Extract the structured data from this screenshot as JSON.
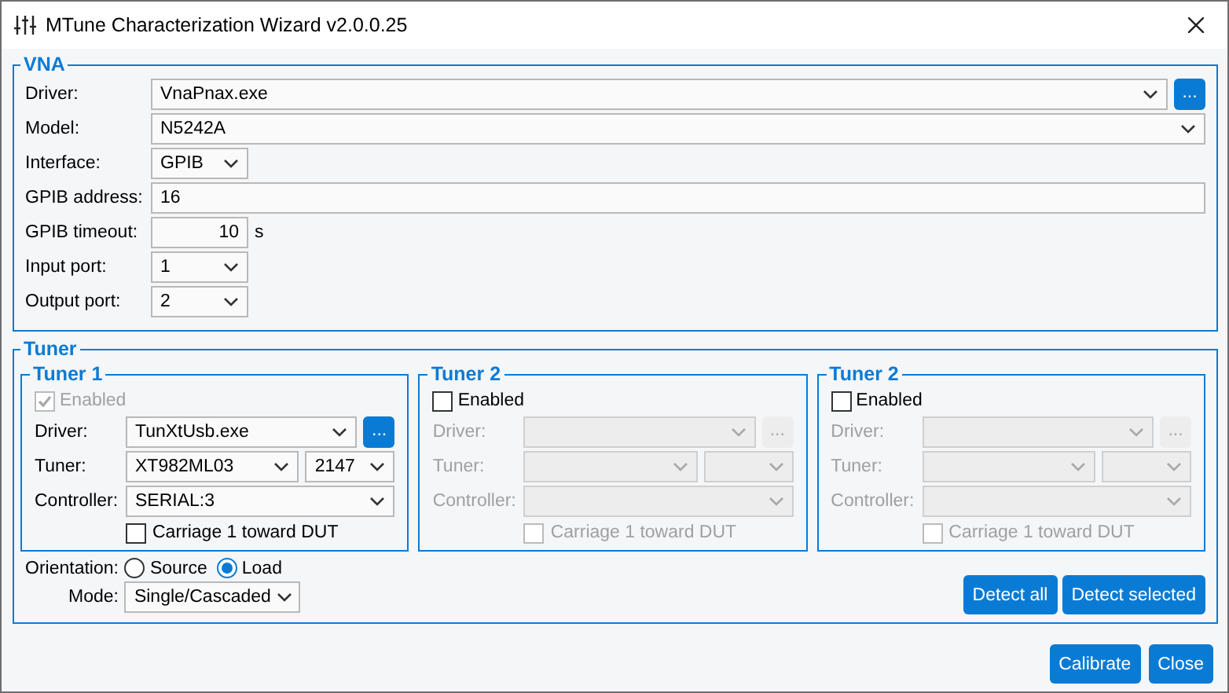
{
  "window": {
    "title": "MTune Characterization Wizard v2.0.0.25"
  },
  "vna": {
    "title": "VNA",
    "rows": [
      {
        "label": "Driver:",
        "kind": "dropdown",
        "value": "VnaPnax.exe",
        "browse_button": "..."
      },
      {
        "label": "Model:",
        "kind": "dropdown",
        "value": "N5242A"
      },
      {
        "label": "Interface:",
        "kind": "short_dropdown",
        "value": "GPIB"
      },
      {
        "label": "GPIB address:",
        "kind": "text",
        "value": "16"
      },
      {
        "label": "GPIB timeout:",
        "kind": "number",
        "value": "10",
        "unit": "s"
      },
      {
        "label": "Input port:",
        "kind": "short_dropdown",
        "value": "1"
      },
      {
        "label": "Output port:",
        "kind": "short_dropdown",
        "value": "2"
      }
    ]
  },
  "tuner": {
    "title": "Tuner",
    "tuners": [
      {
        "title": "Tuner 1",
        "enabled": {
          "label": "Enabled",
          "checked": true,
          "disabled": true
        },
        "controls_disabled": false,
        "driver": {
          "label": "Driver:",
          "value": "TunXtUsb.exe",
          "browse_button": "..."
        },
        "tuner": {
          "label": "Tuner:",
          "model": "XT982ML03",
          "serial": "2147"
        },
        "controller": {
          "label": "Controller:",
          "value": "SERIAL:3"
        },
        "carriage": {
          "label": "Carriage 1 toward DUT",
          "checked": false
        }
      },
      {
        "title": "Tuner 2",
        "enabled": {
          "label": "Enabled",
          "checked": false,
          "disabled": false
        },
        "controls_disabled": true,
        "driver": {
          "label": "Driver:",
          "browse_button": "..."
        },
        "tuner": {
          "label": "Tuner:"
        },
        "controller": {
          "label": "Controller:"
        },
        "carriage": {
          "label": "Carriage 1 toward DUT",
          "checked": false
        }
      },
      {
        "title": "Tuner 2",
        "enabled": {
          "label": "Enabled",
          "checked": false,
          "disabled": false
        },
        "controls_disabled": true,
        "driver": {
          "label": "Driver:",
          "browse_button": "..."
        },
        "tuner": {
          "label": "Tuner:"
        },
        "controller": {
          "label": "Controller:"
        },
        "carriage": {
          "label": "Carriage 1 toward DUT",
          "checked": false
        }
      }
    ],
    "orientation": {
      "label": "Orientation:",
      "options": [
        {
          "label": "Source",
          "selected": false
        },
        {
          "label": "Load",
          "selected": true
        }
      ]
    },
    "mode": {
      "label": "Mode:",
      "value": "Single/Cascaded"
    },
    "buttons": [
      "Detect all",
      "Detect selected"
    ]
  },
  "buttons": [
    "Calibrate",
    "Close"
  ]
}
